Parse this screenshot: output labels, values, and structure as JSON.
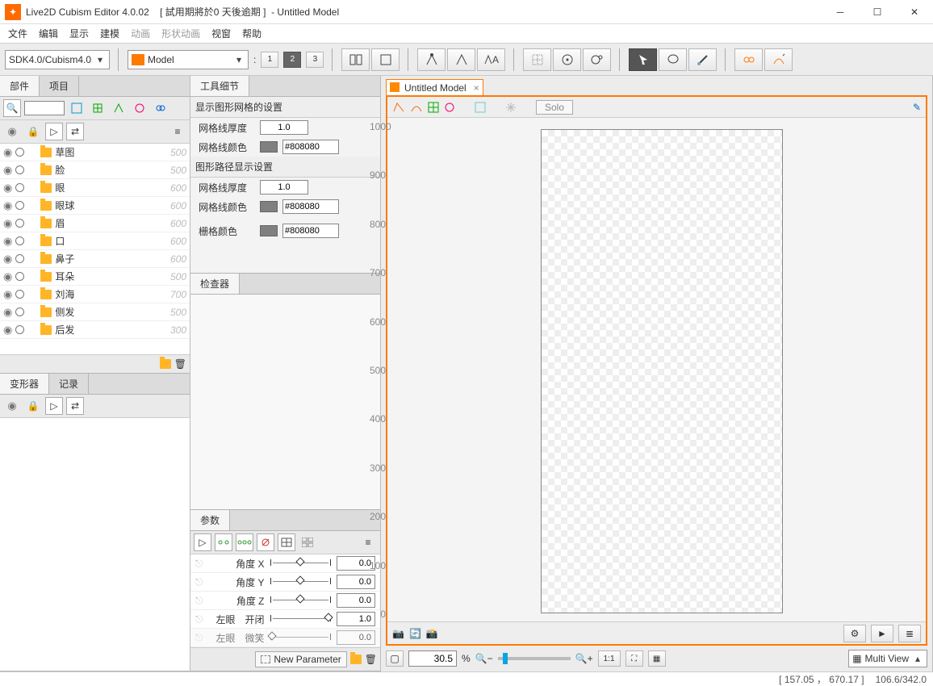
{
  "window": {
    "title": "Live2D Cubism Editor 4.0.02    [ 試用期將於0 天後逾期 ]  - Untitled Model"
  },
  "menu": [
    "文件",
    "编辑",
    "显示",
    "建模",
    "动画",
    "形状动画",
    "视窗",
    "帮助"
  ],
  "menu_disabled": [
    4,
    5
  ],
  "toolbar": {
    "sdk_combo": "SDK4.0/Cubism4.0",
    "mode_combo": "Model",
    "level_prefix": ":",
    "levels": [
      "1",
      "2",
      "3"
    ],
    "level_selected": 1
  },
  "left_tabs": {
    "parts": "部件",
    "project": "项目"
  },
  "parts_tree": [
    {
      "name": "草图",
      "v": "500"
    },
    {
      "name": "脸",
      "v": "500"
    },
    {
      "name": "眼",
      "v": "600"
    },
    {
      "name": "眼球",
      "v": "600"
    },
    {
      "name": "眉",
      "v": "600"
    },
    {
      "name": "口",
      "v": "600"
    },
    {
      "name": "鼻子",
      "v": "600"
    },
    {
      "name": "耳朵",
      "v": "500"
    },
    {
      "name": "刘海",
      "v": "700"
    },
    {
      "name": "侧发",
      "v": "500"
    },
    {
      "name": "后发",
      "v": "300"
    }
  ],
  "left2_tabs": {
    "deformer": "变形器",
    "log": "记录"
  },
  "tool_detail": {
    "tab": "工具细节",
    "sec1": "显示图形网格的设置",
    "line_thickness_label": "网格线厚度",
    "line_thickness": "1.0",
    "line_color_label": "网格线颜色",
    "line_color": "#808080",
    "sec2": "图形路径显示设置",
    "path_thickness_label": "网格线厚度",
    "path_thickness": "1.0",
    "path_color_label": "网格线颜色",
    "path_color": "#808080",
    "grid_color_label": "栅格颜色",
    "grid_color": "#808080"
  },
  "inspector_tab": "检查器",
  "param_tab": "参数",
  "parameters": [
    {
      "label": "角度 X",
      "val": "0.0",
      "pos": 50
    },
    {
      "label": "角度 Y",
      "val": "0.0",
      "pos": 50
    },
    {
      "label": "角度 Z",
      "val": "0.0",
      "pos": 50
    },
    {
      "label": "左眼　开闭",
      "val": "1.0",
      "pos": 95
    },
    {
      "label": "左眼　微笑",
      "val": "0.0",
      "pos": 5
    }
  ],
  "new_param_label": "New Parameter",
  "doc": {
    "title": "Untitled Model",
    "solo": "Solo"
  },
  "ruler_ticks": [
    "1000",
    "900",
    "800",
    "700",
    "600",
    "500",
    "400",
    "300",
    "200",
    "100",
    "0"
  ],
  "zoom": {
    "value": "30.5",
    "pct": "%",
    "one": "1:1",
    "multiview": "Multi View"
  },
  "status": {
    "coords": "[ 157.05 ， 670.17 ]",
    "scale": "106.6/342.0"
  }
}
